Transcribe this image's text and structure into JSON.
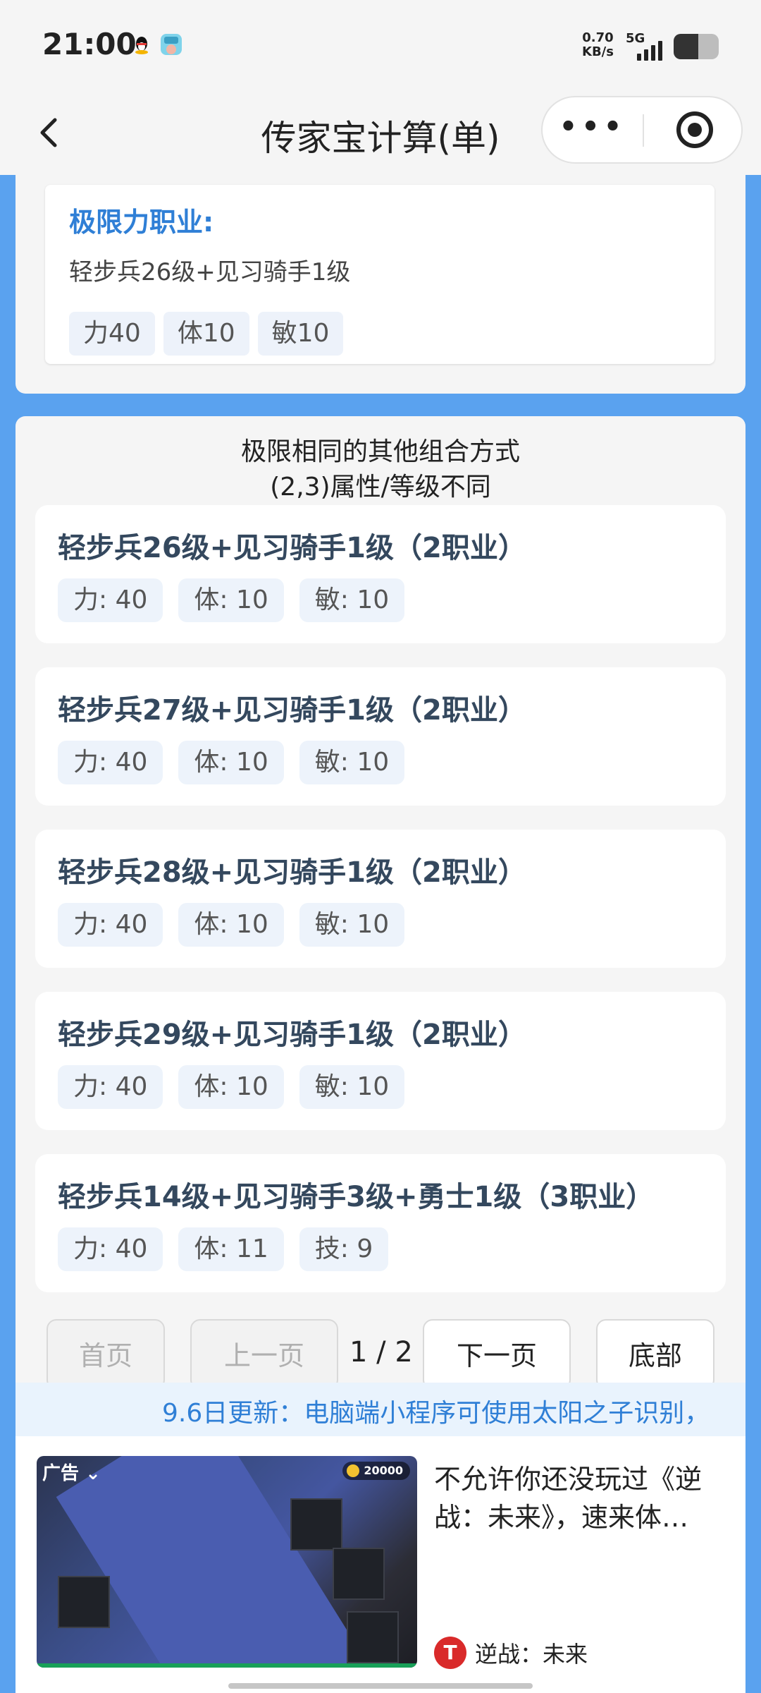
{
  "status_bar": {
    "time": "21:00",
    "net_speed": "0.70",
    "net_unit": "KB/s",
    "network": "5G",
    "battery_level": 0.55
  },
  "nav": {
    "back_icon": "chevron-left",
    "title": "传家宝计算(单)",
    "more_icon": "•••",
    "record_icon": "target"
  },
  "top_card": {
    "title": "极限力职业:",
    "combo": "轻步兵26级+见习骑手1级",
    "tags": [
      "力40",
      "体10",
      "敏10"
    ]
  },
  "others": {
    "heading_line1": "极限相同的其他组合方式",
    "heading_line2": "(2,3)属性/等级不同",
    "items": [
      {
        "title": "轻步兵26级+见习骑手1级（2职业）",
        "tags": [
          "力: 40",
          "体: 10",
          "敏: 10"
        ]
      },
      {
        "title": "轻步兵27级+见习骑手1级（2职业）",
        "tags": [
          "力: 40",
          "体: 10",
          "敏: 10"
        ]
      },
      {
        "title": "轻步兵28级+见习骑手1级（2职业）",
        "tags": [
          "力: 40",
          "体: 10",
          "敏: 10"
        ]
      },
      {
        "title": "轻步兵29级+见习骑手1级（2职业）",
        "tags": [
          "力: 40",
          "体: 10",
          "敏: 10"
        ]
      },
      {
        "title": "轻步兵14级+见习骑手3级+勇士1级（3职业）",
        "tags": [
          "力: 40",
          "体: 11",
          "技: 9"
        ]
      }
    ]
  },
  "pager": {
    "first": "首页",
    "prev": "上一页",
    "info": "1 / 2",
    "next": "下一页",
    "bottom": "底部"
  },
  "marquee": "9.6日更新：电脑端小程序可使用太阳之子识别，",
  "ad": {
    "label": "广告",
    "coins": "20000",
    "text": "不允许你还没玩过《逆战：未来》，速来体…",
    "brand": "逆战：未来",
    "brand_logo": "T"
  },
  "colors": {
    "accent": "#2f7fd6",
    "page_bg": "#5aa2ef"
  }
}
